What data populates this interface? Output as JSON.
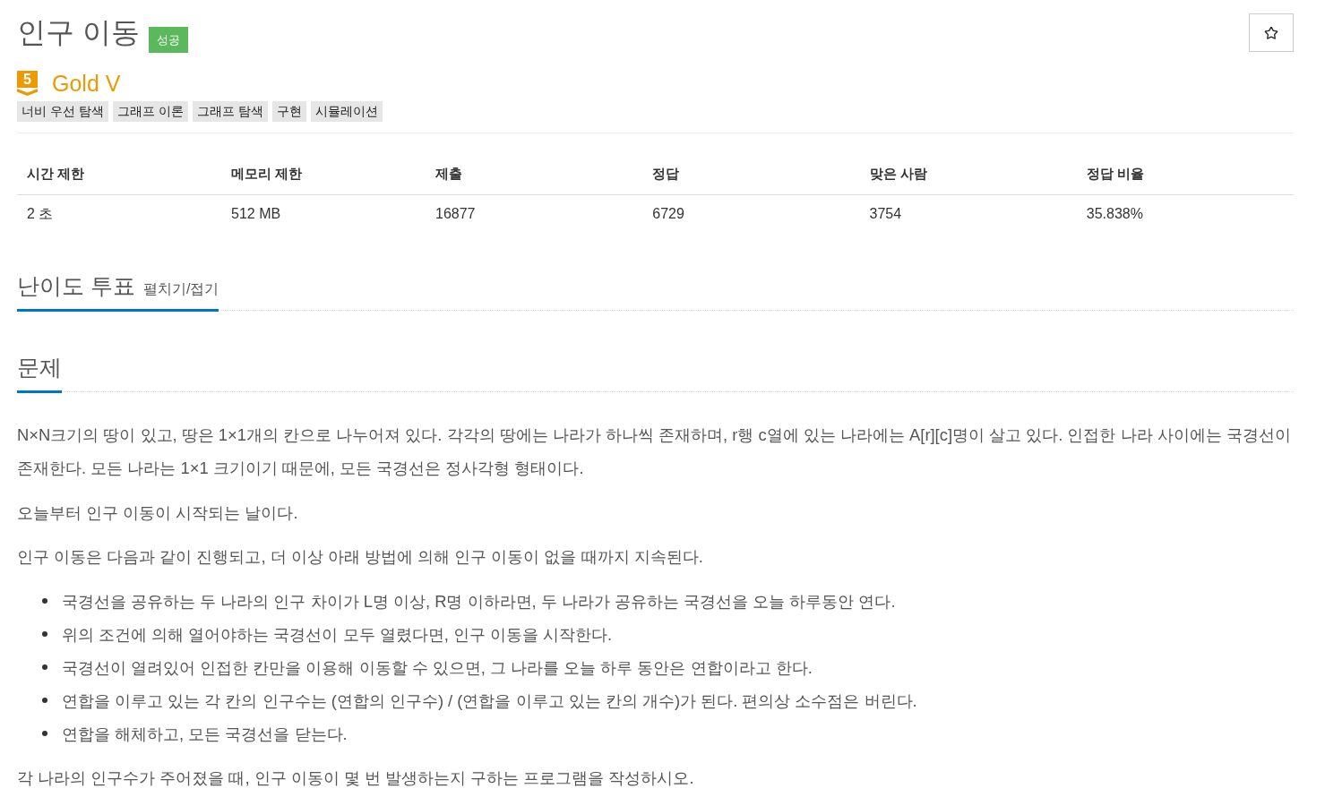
{
  "problem": {
    "title": "인구 이동",
    "result_badge": "성공",
    "starred": false
  },
  "tier": {
    "level": "5",
    "name": "Gold V"
  },
  "tags": [
    "너비 우선 탐색",
    "그래프 이론",
    "그래프 탐색",
    "구현",
    "시뮬레이션"
  ],
  "stats_table": {
    "columns": [
      "시간 제한",
      "메모리 제한",
      "제출",
      "정답",
      "맞은 사람",
      "정답 비율"
    ],
    "rows": [
      [
        "2 초",
        "512 MB",
        "16877",
        "6729",
        "3754",
        "35.838%"
      ]
    ]
  },
  "vote_section": {
    "title": "난이도 투표",
    "toggle_link": "펼치기/접기"
  },
  "problem_section": {
    "title": "문제",
    "content": [
      {
        "kind": "paragraph",
        "text": "N×N크기의 땅이 있고, 땅은 1×1개의 칸으로 나누어져 있다. 각각의 땅에는 나라가 하나씩 존재하며, r행 c열에 있는 나라에는 A[r][c]명이 살고 있다. 인접한 나라 사이에는 국경선이 존재한다. 모든 나라는 1×1 크기이기 때문에, 모든 국경선은 정사각형 형태이다."
      },
      {
        "kind": "paragraph",
        "text": "오늘부터 인구 이동이 시작되는 날이다."
      },
      {
        "kind": "paragraph",
        "text": "인구 이동은 다음과 같이 진행되고, 더 이상 아래 방법에 의해 인구 이동이 없을 때까지 지속된다."
      },
      {
        "kind": "bullets",
        "items": [
          "국경선을 공유하는 두 나라의 인구 차이가 L명 이상, R명 이하라면, 두 나라가 공유하는 국경선을 오늘 하루동안 연다.",
          "위의 조건에 의해 열어야하는 국경선이 모두 열렸다면, 인구 이동을 시작한다.",
          "국경선이 열려있어 인접한 칸만을 이용해 이동할 수 있으면, 그 나라를 오늘 하루 동안은 연합이라고 한다.",
          "연합을 이루고 있는 각 칸의 인구수는 (연합의 인구수) / (연합을 이루고 있는 칸의 개수)가 된다. 편의상 소수점은 버린다.",
          "연합을 해체하고, 모든 국경선을 닫는다."
        ]
      },
      {
        "kind": "paragraph",
        "text": "각 나라의 인구수가 주어졌을 때, 인구 이동이 몇 번 발생하는지 구하는 프로그램을 작성하시오."
      }
    ]
  }
}
